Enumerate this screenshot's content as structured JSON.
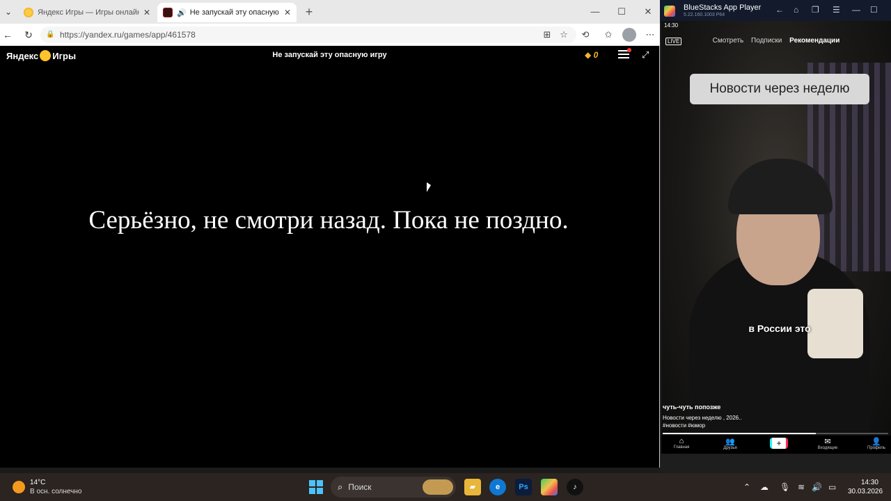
{
  "browser": {
    "tabs": [
      {
        "title": "Яндекс Игры — Игры онлайн бе",
        "active": false
      },
      {
        "title": "Не запускай эту опасную иг",
        "active": true
      }
    ],
    "url": "https://yandex.ru/games/app/461578"
  },
  "game": {
    "logo": "Яндекс",
    "logo_suffix": "Игры",
    "title": "Не запускай эту опасную игру",
    "coins": "0",
    "message": "Серьёзно, не смотри назад. Пока не поздно."
  },
  "bluestacks": {
    "title": "BlueStacks App Player",
    "version": "5.22.160.1003 P64",
    "status_time": "14:30",
    "tabs": [
      "Смотреть",
      "Подписки",
      "Рекомендации"
    ],
    "active_tab": "Рекомендации",
    "caption_top": "Новости через неделю",
    "caption_sub": "в России это",
    "author": "чуть-чуть попозже",
    "description_line1": "Новости через неделю , 2026..",
    "description_line2": "#новости #юмор",
    "progress": 0.68,
    "nav": [
      "Главная",
      "Друзья",
      "Входящие",
      "Профиль"
    ]
  },
  "taskbar": {
    "weather_temp": "14°C",
    "weather_desc": "В осн. солнечно",
    "search_placeholder": "Поиск",
    "time": "14:30",
    "date": "30.03.2026"
  },
  "colors": {
    "start_blue": "#4cc2ff",
    "coin": "#f1b42f",
    "game_bg": "#000000"
  }
}
